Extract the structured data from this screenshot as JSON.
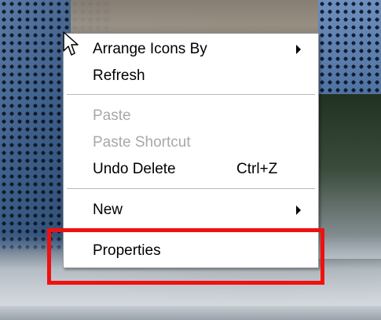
{
  "menu": {
    "items": [
      {
        "label": "Arrange Icons By",
        "has_submenu": true,
        "enabled": true
      },
      {
        "label": "Refresh",
        "enabled": true
      },
      {
        "label": "Paste",
        "enabled": false
      },
      {
        "label": "Paste Shortcut",
        "enabled": false
      },
      {
        "label": "Undo Delete",
        "shortcut": "Ctrl+Z",
        "enabled": true
      },
      {
        "label": "New",
        "has_submenu": true,
        "enabled": true
      },
      {
        "label": "Properties",
        "enabled": true
      }
    ]
  },
  "colors": {
    "highlight_box": "#f01010",
    "disabled_text": "#a8a8a8",
    "menu_background": "#ffffff"
  },
  "icons": {
    "cursor": "mouse-pointer-icon",
    "submenu_arrow": "submenu-arrow-icon"
  }
}
